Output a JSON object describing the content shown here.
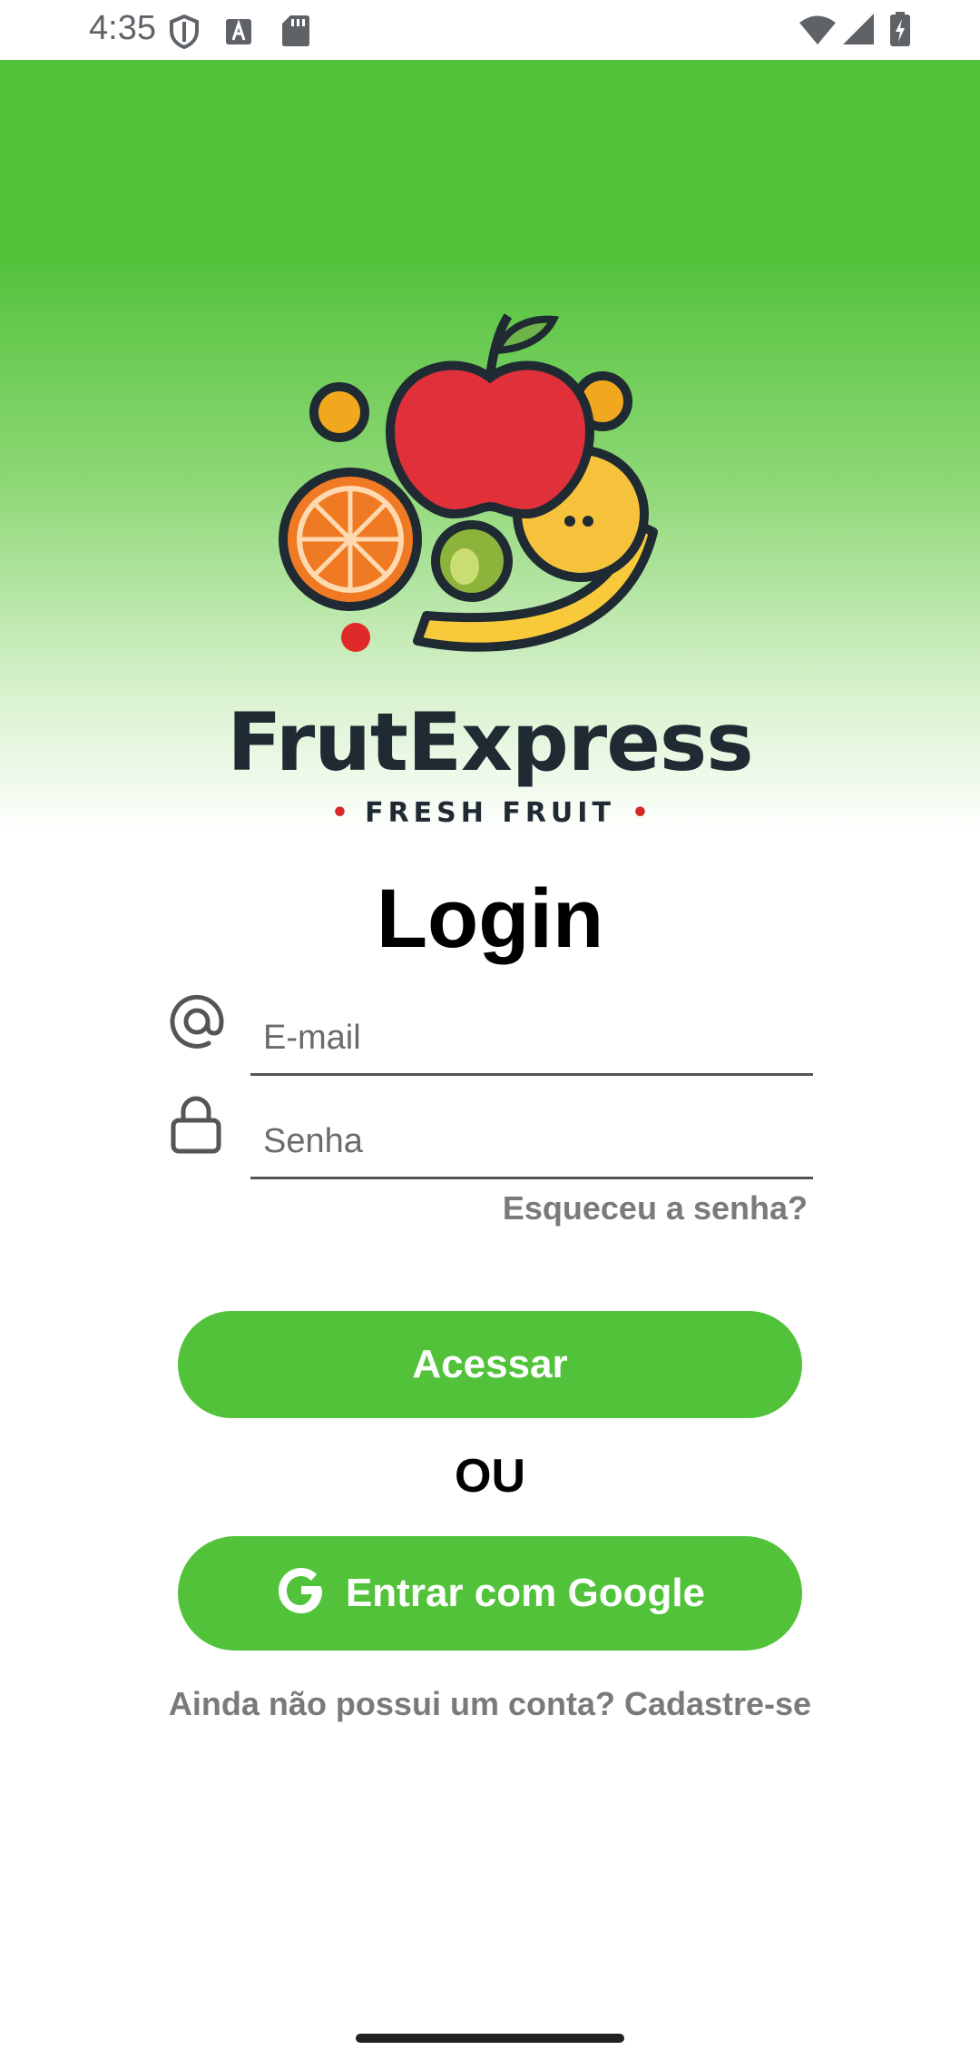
{
  "status_bar": {
    "time": "4:35",
    "icons": [
      "shield-icon",
      "a-badge-icon",
      "sd-card-icon",
      "wifi-icon",
      "signal-icon",
      "battery-charging-icon"
    ]
  },
  "brand": {
    "name": "FrutExpress",
    "tagline": "FRESH FRUIT",
    "logo_icon": "fruit-basket-logo"
  },
  "login": {
    "title": "Login",
    "email_placeholder": "E-mail",
    "email_icon": "at-sign-icon",
    "password_placeholder": "Senha",
    "password_icon": "lock-icon",
    "forgot_password": "Esqueceu a senha?",
    "submit_label": "Acessar",
    "or_label": "OU",
    "google_label": "Entrar com Google",
    "google_icon": "google-g-icon",
    "signup_prompt": "Ainda não possui um conta? Cadastre-se"
  },
  "colors": {
    "primary": "#52c23a",
    "link_gray": "#7a7a7a",
    "brand_dark": "#1f2a33",
    "accent_red": "#d42a2a"
  }
}
